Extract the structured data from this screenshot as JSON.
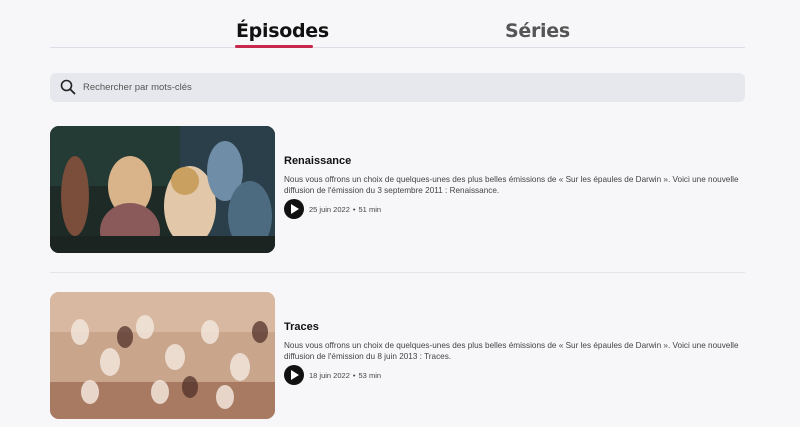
{
  "tabs": [
    {
      "label": "Épisodes",
      "active": true
    },
    {
      "label": "Séries",
      "active": false
    }
  ],
  "search": {
    "placeholder": "Rechercher par mots-clés",
    "value": "",
    "icon": "search-icon"
  },
  "accent_color": "#c8284d",
  "episodes": [
    {
      "title": "Renaissance",
      "description": "Nous vous offrons un choix de quelques-unes des plus belles émissions de « Sur les épaules de Darwin ». Voici une nouvelle diffusion de l'émission du 3 septembre 2011 : Renaissance.",
      "date": "25 juin 2022",
      "separator": "•",
      "duration": "51 min",
      "play_icon": "play-icon"
    },
    {
      "title": "Traces",
      "description": "Nous vous offrons un choix de quelques-unes des plus belles émissions de « Sur les épaules de Darwin ». Voici une nouvelle diffusion de l'émission du 8 juin 2013 : Traces.",
      "date": "18 juin 2022",
      "separator": "•",
      "duration": "53 min",
      "play_icon": "play-icon"
    }
  ]
}
